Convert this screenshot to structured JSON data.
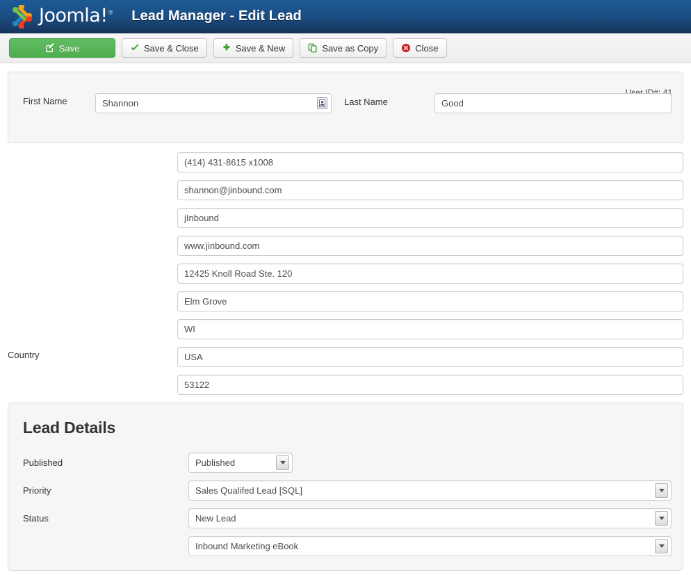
{
  "header": {
    "logo_text": "Joomla!",
    "logo_registered": "®",
    "title": "Lead Manager - Edit Lead",
    "brand_colors": {
      "green": "#7ac143",
      "orange": "#f9a11b",
      "blue": "#1f88c4",
      "red": "#ee3d23",
      "bar_top": "#1c5b96",
      "bar_bottom": "#16365d"
    }
  },
  "toolbar": {
    "save_label": "Save",
    "save_close_label": "Save & Close",
    "save_new_label": "Save & New",
    "save_copy_label": "Save as Copy",
    "close_label": "Close",
    "save_color": "#4fad4f",
    "icon_green": "#3f9c35",
    "icon_red": "#cc2229"
  },
  "name_panel": {
    "user_id_text": "User ID#: 41",
    "first_name_label": "First Name",
    "first_name_value": "Shannon",
    "first_name_picker_icon": "user-picker-icon",
    "last_name_label": "Last Name",
    "last_name_value": "Good"
  },
  "contact_fields": [
    {
      "label": "",
      "value": "(414) 431-8615 x1008",
      "name": "phone"
    },
    {
      "label": "",
      "value": "shannon@jinbound.com",
      "name": "email"
    },
    {
      "label": "",
      "value": "jInbound",
      "name": "company"
    },
    {
      "label": "",
      "value": "www.jinbound.com",
      "name": "website"
    },
    {
      "label": "",
      "value": "12425 Knoll Road Ste. 120",
      "name": "address"
    },
    {
      "label": "",
      "value": "Elm Grove",
      "name": "city"
    },
    {
      "label": "",
      "value": "WI",
      "name": "state"
    },
    {
      "label": "Country",
      "value": "USA",
      "name": "country"
    },
    {
      "label": "",
      "value": "53122",
      "name": "postal-code"
    }
  ],
  "lead_details": {
    "title": "Lead Details",
    "rows": [
      {
        "label": "Published",
        "value": "Published",
        "name": "published",
        "size": "small"
      },
      {
        "label": "Priority",
        "value": "Sales Qualifed Lead [SQL]",
        "name": "priority",
        "size": "large"
      },
      {
        "label": "Status",
        "value": "New Lead",
        "name": "status",
        "size": "large"
      },
      {
        "label": "",
        "value": "Inbound Marketing eBook",
        "name": "campaign",
        "size": "large"
      }
    ]
  }
}
